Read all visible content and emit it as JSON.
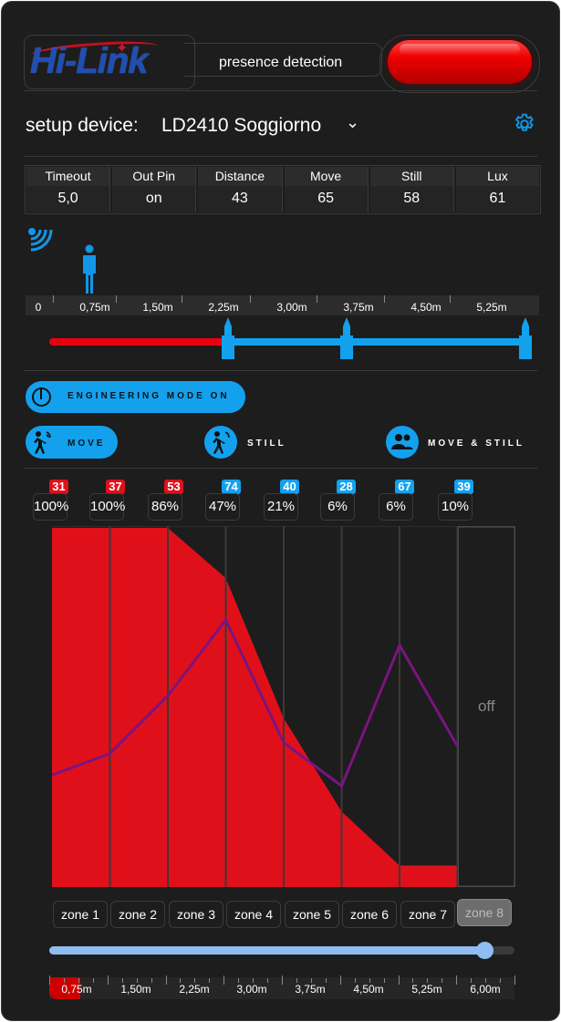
{
  "header": {
    "logo_text": "Hi-Link",
    "title": "presence detection",
    "led_color": "#ee0000"
  },
  "setup": {
    "label": "setup device:",
    "device": "LD2410 Soggiorno",
    "settings_icon": "gear-icon"
  },
  "params": [
    {
      "label": "Timeout",
      "value": "5,0"
    },
    {
      "label": "Out Pin",
      "value": "on"
    },
    {
      "label": "Distance",
      "value": "43"
    },
    {
      "label": "Move",
      "value": "65"
    },
    {
      "label": "Still",
      "value": "58"
    },
    {
      "label": "Lux",
      "value": "61"
    }
  ],
  "distance_scale": [
    "0",
    "0,75m",
    "1,50m",
    "2,25m",
    "3,00m",
    "3,75m",
    "4,50m",
    "5,25m"
  ],
  "range_bar": {
    "red_end_m": 2.25,
    "gates_m": [
      2.25,
      3.75,
      6.0
    ],
    "max_m": 6.0,
    "red": "#e8000f",
    "blue": "#13a1ee"
  },
  "engineering": {
    "label": "ENGINEERING MODE ON"
  },
  "modes": {
    "move": "MOVE",
    "still": "STILL",
    "move_still": "MOVE & STILL"
  },
  "zones": [
    {
      "name": "zone 1",
      "threshold": "31",
      "pct": "100%",
      "energy": 100,
      "line": 31,
      "color": "#e0101a"
    },
    {
      "name": "zone 2",
      "threshold": "37",
      "pct": "100%",
      "energy": 100,
      "line": 37,
      "color": "#e0101a"
    },
    {
      "name": "zone 3",
      "threshold": "53",
      "pct": "86%",
      "energy": 86,
      "line": 53,
      "color": "#e0101a"
    },
    {
      "name": "zone 4",
      "threshold": "74",
      "pct": "47%",
      "energy": 47,
      "line": 74,
      "color": "#13a1ee"
    },
    {
      "name": "zone 5",
      "threshold": "40",
      "pct": "21%",
      "energy": 21,
      "line": 40,
      "color": "#13a1ee"
    },
    {
      "name": "zone 6",
      "threshold": "28",
      "pct": "6%",
      "energy": 6,
      "line": 28,
      "color": "#13a1ee"
    },
    {
      "name": "zone 7",
      "threshold": "67",
      "pct": "6%",
      "energy": 6,
      "line": 67,
      "color": "#13a1ee"
    },
    {
      "name": "zone 8",
      "threshold": "39",
      "pct": "10%",
      "energy": 10,
      "line": 39,
      "color": "#13a1ee",
      "state": "off"
    }
  ],
  "chart_off_label": "off",
  "slider": {
    "value_m": 5.62,
    "max_m": 6.0
  },
  "bottom_scale": [
    "0,75m",
    "1,50m",
    "2,25m",
    "3,00m",
    "3,75m",
    "4,50m",
    "5,25m",
    "6,00m"
  ]
}
